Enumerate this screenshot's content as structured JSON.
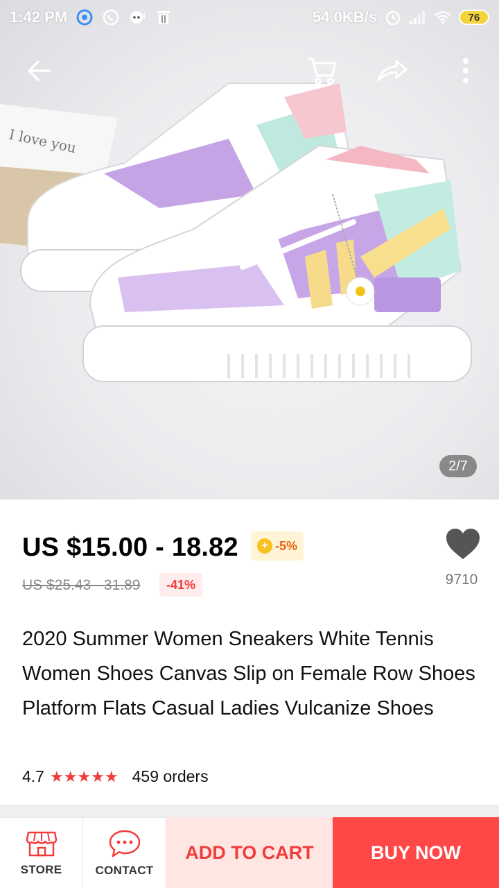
{
  "status_bar": {
    "time": "1:42 PM",
    "network_speed": "54.0KB/s",
    "battery": "76",
    "icons": [
      "messages-icon",
      "whatsapp-icon",
      "chat-icon",
      "trash-icon",
      "alarm-icon",
      "signal-icon",
      "wifi-icon",
      "battery-icon"
    ]
  },
  "app_bar": {
    "icons": [
      "back-arrow-icon",
      "cart-icon",
      "share-icon",
      "more-icon"
    ]
  },
  "gallery": {
    "counter": "2/7"
  },
  "product": {
    "price": "US $15.00 - 18.82",
    "coin_discount": "-5%",
    "original_price": "US $25.43 - 31.89",
    "discount": "-41%",
    "wishlist_count": "9710",
    "title": "2020 Summer Women Sneakers White Tennis Women Shoes Canvas Slip on Female Row Shoes Platform Flats Casual Ladies Vulcanize Shoes",
    "rating": "4.7",
    "stars": "★★★★★",
    "orders": "459 orders"
  },
  "bottom_bar": {
    "store_label": "STORE",
    "contact_label": "CONTACT",
    "add_to_cart_label": "ADD TO CART",
    "buy_now_label": "BUY NOW"
  },
  "colors": {
    "accent": "#ff4747",
    "accent_light": "#ffe6e2",
    "price_badge_bg": "#fff4d6",
    "discount_text": "#f23b3b"
  }
}
